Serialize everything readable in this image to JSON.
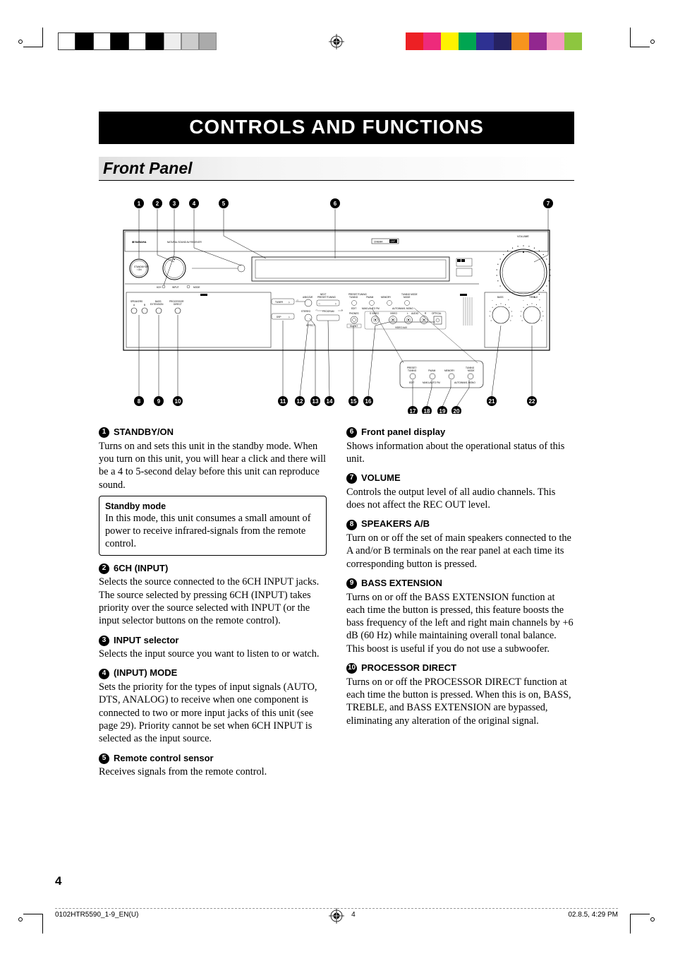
{
  "banner": "CONTROLS AND FUNCTIONS",
  "section": "Front Panel",
  "callouts": [
    "1",
    "2",
    "3",
    "4",
    "5",
    "6",
    "7",
    "8",
    "9",
    "10",
    "11",
    "12",
    "13",
    "14",
    "15",
    "16",
    "17",
    "18",
    "19",
    "20",
    "21",
    "22"
  ],
  "diagram_labels": {
    "brand": "YAMAHA",
    "subtitle": "NATURAL SOUND  AV RECEIVER",
    "cinema": "CINEMA",
    "dsp": "DSP",
    "volume": "VOLUME",
    "bass": "BASS",
    "treble": "TREBLE",
    "standby": "STANDBY/ON",
    "sixch": "6CH",
    "input": "INPUT",
    "mode": "MODE",
    "speakers": "SPEAKERS",
    "a": "A",
    "b": "B",
    "bass_ext": "BASS EXTENSION",
    "proc_dir": "PROCESSOR DIRECT",
    "stereo": "STEREO",
    "program": "PROGRAM",
    "effect": "EFFECT",
    "tuner": "TUNER",
    "dsp_btn": "DSP",
    "preset": "PRESET/TUNING",
    "abcde": "A/B/C/D/E",
    "next": "NEXT",
    "preset2": "PRESET/TUNING",
    "fmam": "FM/AM",
    "memory": "MEMORY",
    "man": "MAN'L/AUTO FM",
    "auto": "AUTO/MAN'L MONO",
    "edit": "EDIT",
    "tuning": "TUNING MODE",
    "phones": "PHONES",
    "silent": "SILENT",
    "svideo": "S VIDEO",
    "video": "VIDEO",
    "l": "L",
    "audio": "AUDIO",
    "r": "R",
    "optical": "OPTICAL",
    "videoaux": "VIDEO AUX"
  },
  "left": [
    {
      "n": "1",
      "t": "STANDBY/ON",
      "b": "Turns on and sets this unit in the standby mode. When you turn on this unit, you will hear a click and there will be a 4 to 5-second delay before this unit can reproduce sound."
    },
    {
      "box_t": "Standby mode",
      "box_b": "In this mode, this unit consumes a small amount of power to receive infrared-signals from the remote control."
    },
    {
      "n": "2",
      "t": "6CH (INPUT)",
      "b": "Selects the source connected to the 6CH INPUT jacks. The source selected by pressing 6CH (INPUT) takes priority over the source selected with INPUT (or the input selector buttons on the remote control)."
    },
    {
      "n": "3",
      "t": "INPUT selector",
      "b": "Selects the input source you want to listen to or watch."
    },
    {
      "n": "4",
      "t": "(INPUT) MODE",
      "b": "Sets the priority for the types of input signals (AUTO, DTS, ANALOG) to receive when one component is connected to two or more input jacks of this unit (see page 29). Priority cannot be set when 6CH INPUT is selected as the input source."
    },
    {
      "n": "5",
      "t": "Remote control sensor",
      "b": "Receives signals from the remote control."
    }
  ],
  "right": [
    {
      "n": "6",
      "t": "Front panel display",
      "b": "Shows information about the operational status of this unit."
    },
    {
      "n": "7",
      "t": "VOLUME",
      "b": "Controls the output level of all audio channels. This does not affect the REC OUT level."
    },
    {
      "n": "8",
      "t": "SPEAKERS A/B",
      "b": "Turn on or off the set of main speakers connected to the A and/or B terminals on the rear panel at each time its corresponding button is pressed."
    },
    {
      "n": "9",
      "t": "BASS EXTENSION",
      "b": "Turns on or off the BASS EXTENSION function at each time the button is pressed, this feature boosts the bass frequency of the left and right main channels by +6 dB (60 Hz) while maintaining overall tonal balance. This boost is useful if you do not use a subwoofer."
    },
    {
      "n": "10",
      "t": "PROCESSOR DIRECT",
      "b": "Turns on or off the PROCESSOR DIRECT function at each time the button is pressed. When this is on, BASS, TREBLE, and BASS EXTENSION are bypassed, eliminating any alteration of the original signal."
    }
  ],
  "page": "4",
  "footer": {
    "file": "0102HTR5590_1-9_EN(U)",
    "pg": "4",
    "date": "02.8.5, 4:29 PM"
  }
}
